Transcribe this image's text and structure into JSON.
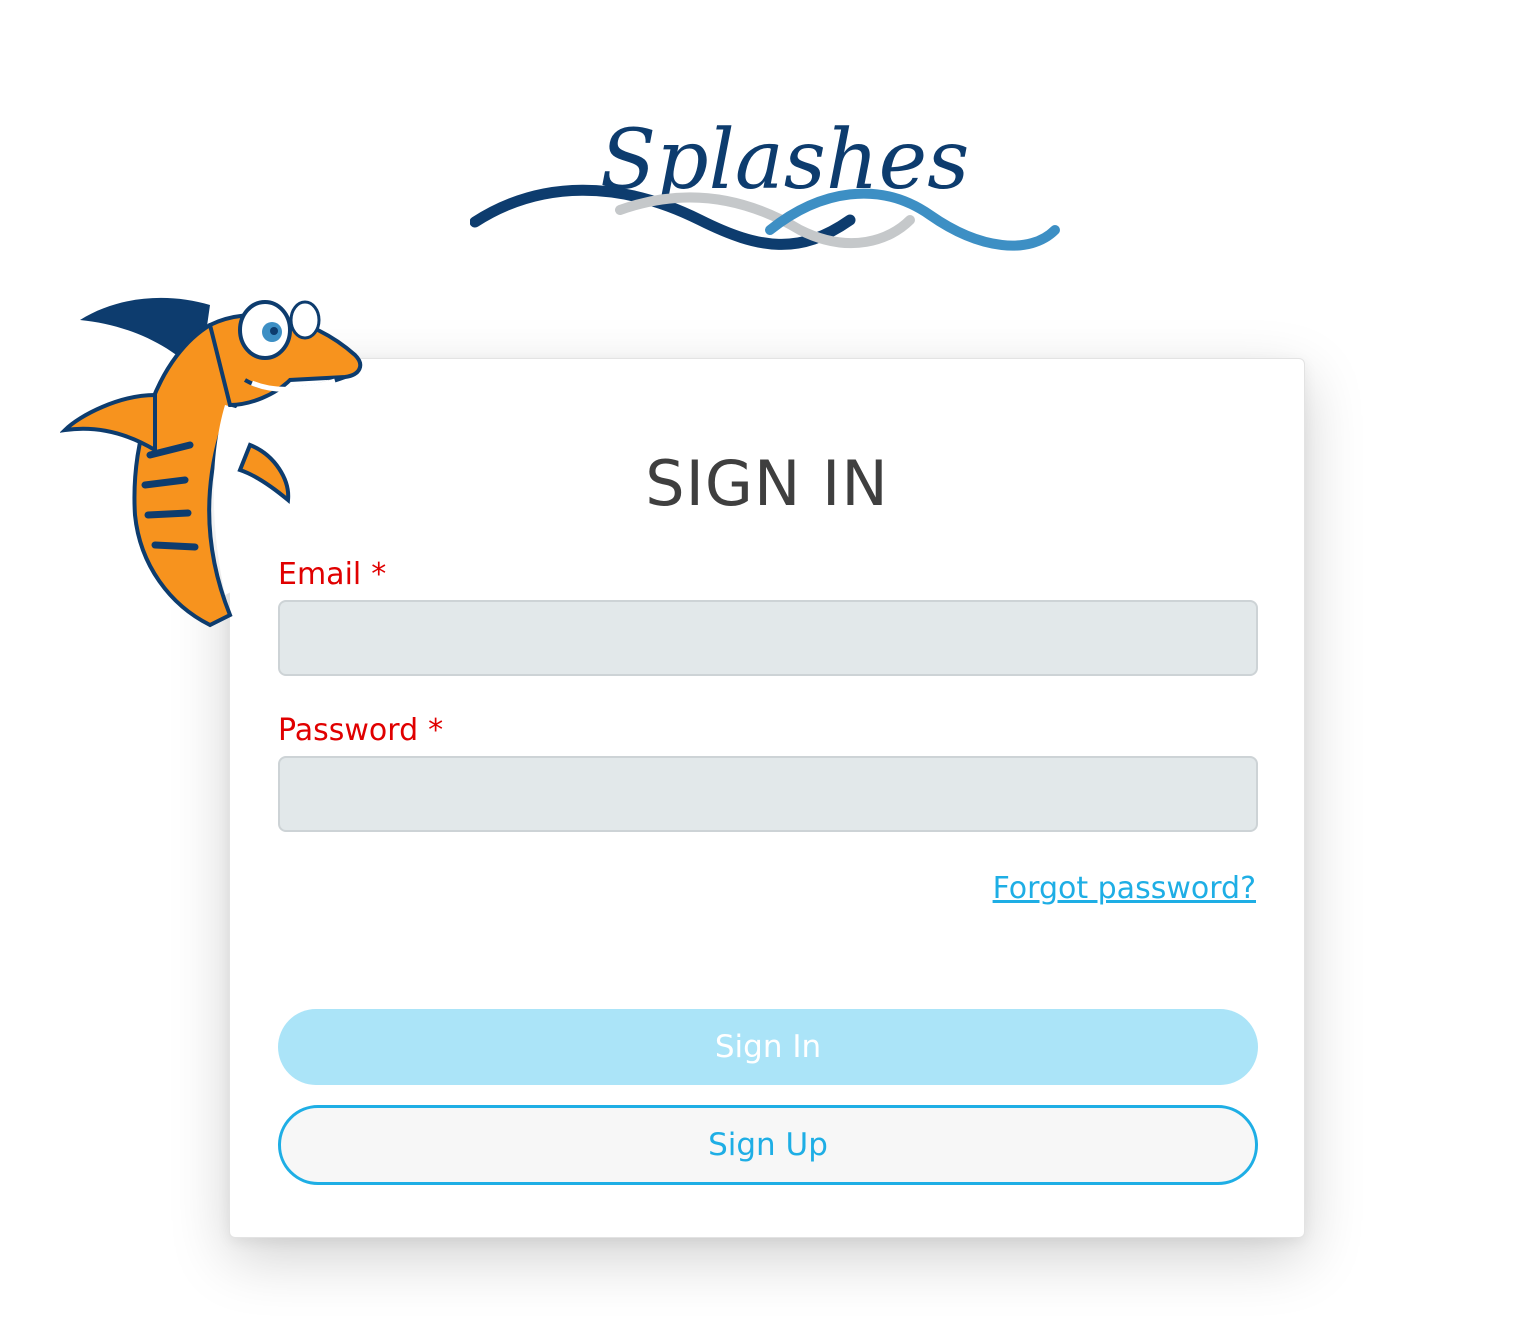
{
  "logo": {
    "text": "Splashes"
  },
  "form": {
    "title": "SIGN IN",
    "email_label": "Email",
    "password_label": "Password",
    "required_mark": "*",
    "email_value": "",
    "password_value": "",
    "forgot_link": "Forgot password?",
    "signin_button": "Sign In",
    "signup_button": "Sign Up"
  },
  "colors": {
    "accent": "#1eaee5",
    "accent_light": "#abe4f8",
    "required": "#e00000",
    "title": "#3f3f3f",
    "input_bg": "#e2e8ea",
    "logo_dark": "#0d3c6e",
    "logo_light": "#3d8fc4",
    "mascot_orange": "#f7931e"
  }
}
